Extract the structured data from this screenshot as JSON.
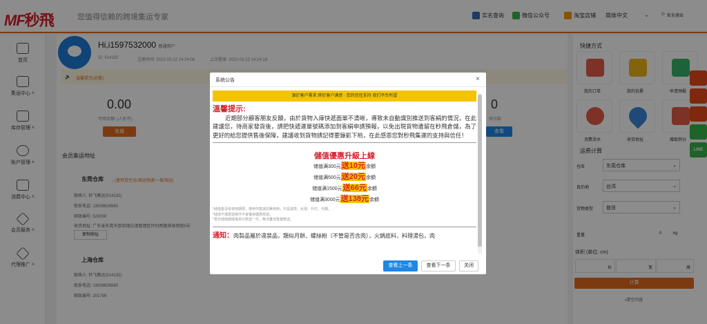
{
  "header": {
    "logo_latin": "MF",
    "logo_cn": "秒飛",
    "slogan": "您值得信赖的跨境集运专家",
    "links": [
      "实名查询",
      "微信公众号",
      "淘宝店铺",
      "简体中文",
      "安全退出"
    ]
  },
  "sidebar": {
    "items": [
      "首页",
      "集运中心",
      "库存管理",
      "账户管理",
      "消费中心",
      "会员服务",
      "代理推广"
    ]
  },
  "user": {
    "greeting": "Hi,i1597532000",
    "level": "普通用户",
    "id": "ID: 514132",
    "register_time": "注册时间: 2022-03-22 14:24:08",
    "last_login": "上次登录: 2022-03-22 14:24:19",
    "notice": "温馨提示(必看)"
  },
  "stats": {
    "balance_value": "0.00",
    "balance_label": "可用余额: (人民币)",
    "recharge_button": "充值",
    "pending_value": "0",
    "pending_label": "待付款",
    "view_button": "查看"
  },
  "warehouses": {
    "section_title": "会员集运地址",
    "dongguan": {
      "name": "东莞仓库",
      "tag": "→(普特货空运/海运快递/一般海运)",
      "contact": "联络人: 秒飞集运(514132)",
      "phone": "联系电话: 13008826560",
      "postcode": "邮政编号: 523000",
      "address": "收货地址: 广东省东莞市厚街镇白濠管理区环村西路草坳南街5号",
      "copy_button": "复制地址"
    },
    "shanghai": {
      "name": "上海仓库",
      "contact": "联络人: 秒飞集运(514132)",
      "phone": "联系电话: 13008826560",
      "postcode": "邮政编号: 201799"
    }
  },
  "quick": {
    "title": "快捷方式",
    "tiles": [
      "我的订单",
      "我的包裹",
      "申请预报",
      "消费流水",
      "收货地址",
      "赠取积分"
    ]
  },
  "calculator": {
    "title": "运费计算",
    "warehouse_label": "仓库",
    "warehouse_value": "东莞仓库",
    "destination_label": "目的地",
    "destination_value": "台湾",
    "cargo_label": "货物类型",
    "cargo_value": "普货",
    "weight_label": "重量",
    "weight_value": "0",
    "weight_unit": "kg",
    "volume_label": "体积 (单位: cm)",
    "length": "长",
    "width": "宽",
    "height": "高",
    "calc_button": "计算",
    "clear": "清空内容"
  },
  "float_buttons": [
    "LINE"
  ],
  "modal": {
    "title": "系统公告",
    "close": "×",
    "banner": "源於客户需求 終於客户满意 · 您的信任支持 我们不负所望",
    "reminder_title": "溫馨提示:",
    "reminder_text": "近期部分顧客朋友反饋，由於貨物入庫快遞面單不清晰，導致未自動識別推送到客絹的情況，在此建議您，待商家發貨後，請把快遞運單號碼添加到客絹申請預報，以免出現貨物遺留在秒飛倉儲，為了更好的給您提供售後保障，建議收到貨物請記得要錄影下哟，在此感恩您對秒飛集運的支持與信任！",
    "promo_title": "儲值優惠升級上線",
    "promos": [
      {
        "pre": "储值满300元",
        "hl": "送10元",
        "post": "余額"
      },
      {
        "pre": "储值满500元",
        "hl": "送20元",
        "post": "余額"
      },
      {
        "pre": "储值满1500元",
        "hl": "送66元",
        "post": "余額"
      },
      {
        "pre": "储值满3000元",
        "hl": "送138元",
        "post": "余額"
      }
    ],
    "footnotes": [
      "*储值金没有使用期限，僅用作集運扣費使用，不設退款、兌現、代付、代購。",
      "*储值不滿限送條件不會獲得優惠贈送。",
      "*當天储值額度最高只贈送一次，無法疊加重複贈送。"
    ],
    "notice_title": "通知：",
    "notice_text": "肉製品屬於違禁品，類似月餅、螺絲粉（不管是否含肉），火鍋底料，料理湯包，肉",
    "btn_prev": "查看上一条",
    "btn_next": "查看下一条",
    "btn_close": "关闭"
  }
}
